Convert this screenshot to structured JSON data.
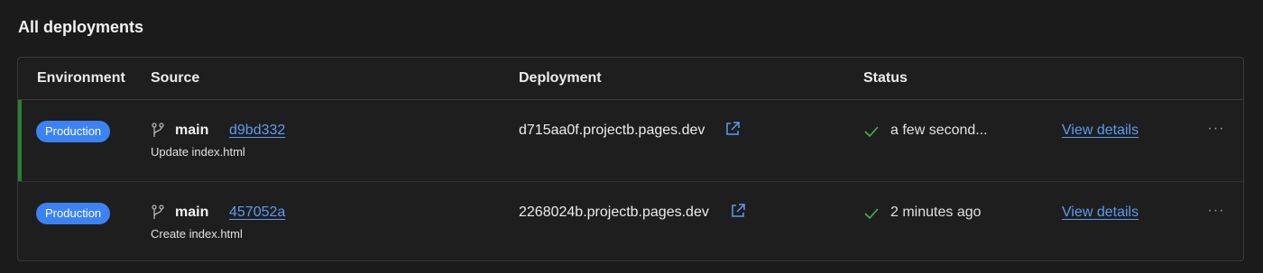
{
  "section": {
    "title": "All deployments"
  },
  "table": {
    "headers": {
      "environment": "Environment",
      "source": "Source",
      "deployment": "Deployment",
      "status": "Status"
    },
    "rows": [
      {
        "environment": "Production",
        "branch": "main",
        "commit": "d9bd332",
        "message": "Update index.html",
        "url": "d715aa0f.projectb.pages.dev",
        "status": "a few second...",
        "status_icon": "check-icon",
        "action": "View details",
        "menu": "···",
        "active": true
      },
      {
        "environment": "Production",
        "branch": "main",
        "commit": "457052a",
        "message": "Create index.html",
        "url": "2268024b.projectb.pages.dev",
        "status": "2 minutes ago",
        "status_icon": "check-icon",
        "action": "View details",
        "menu": "···",
        "active": false
      }
    ]
  },
  "colors": {
    "background": "#1b1b1b",
    "badge": "#3b82f6",
    "link": "#5b9cf2",
    "success": "#4caf50",
    "active_bar": "#2e7d32"
  }
}
